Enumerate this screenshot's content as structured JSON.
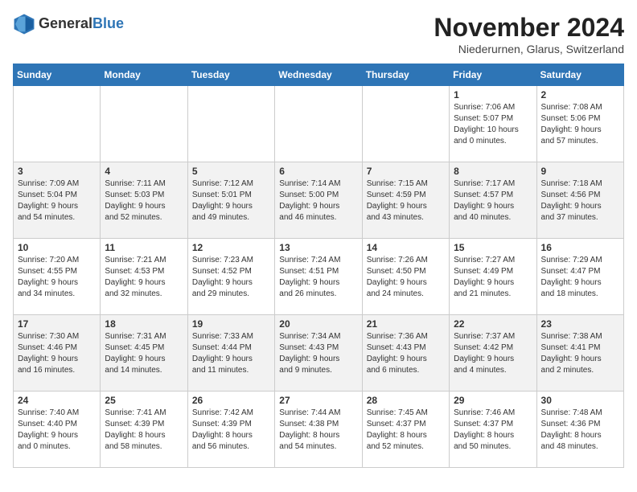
{
  "logo": {
    "general": "General",
    "blue": "Blue"
  },
  "header": {
    "month_title": "November 2024",
    "subtitle": "Niederurnen, Glarus, Switzerland"
  },
  "weekdays": [
    "Sunday",
    "Monday",
    "Tuesday",
    "Wednesday",
    "Thursday",
    "Friday",
    "Saturday"
  ],
  "weeks": [
    [
      {
        "day": "",
        "info": ""
      },
      {
        "day": "",
        "info": ""
      },
      {
        "day": "",
        "info": ""
      },
      {
        "day": "",
        "info": ""
      },
      {
        "day": "",
        "info": ""
      },
      {
        "day": "1",
        "info": "Sunrise: 7:06 AM\nSunset: 5:07 PM\nDaylight: 10 hours\nand 0 minutes."
      },
      {
        "day": "2",
        "info": "Sunrise: 7:08 AM\nSunset: 5:06 PM\nDaylight: 9 hours\nand 57 minutes."
      }
    ],
    [
      {
        "day": "3",
        "info": "Sunrise: 7:09 AM\nSunset: 5:04 PM\nDaylight: 9 hours\nand 54 minutes."
      },
      {
        "day": "4",
        "info": "Sunrise: 7:11 AM\nSunset: 5:03 PM\nDaylight: 9 hours\nand 52 minutes."
      },
      {
        "day": "5",
        "info": "Sunrise: 7:12 AM\nSunset: 5:01 PM\nDaylight: 9 hours\nand 49 minutes."
      },
      {
        "day": "6",
        "info": "Sunrise: 7:14 AM\nSunset: 5:00 PM\nDaylight: 9 hours\nand 46 minutes."
      },
      {
        "day": "7",
        "info": "Sunrise: 7:15 AM\nSunset: 4:59 PM\nDaylight: 9 hours\nand 43 minutes."
      },
      {
        "day": "8",
        "info": "Sunrise: 7:17 AM\nSunset: 4:57 PM\nDaylight: 9 hours\nand 40 minutes."
      },
      {
        "day": "9",
        "info": "Sunrise: 7:18 AM\nSunset: 4:56 PM\nDaylight: 9 hours\nand 37 minutes."
      }
    ],
    [
      {
        "day": "10",
        "info": "Sunrise: 7:20 AM\nSunset: 4:55 PM\nDaylight: 9 hours\nand 34 minutes."
      },
      {
        "day": "11",
        "info": "Sunrise: 7:21 AM\nSunset: 4:53 PM\nDaylight: 9 hours\nand 32 minutes."
      },
      {
        "day": "12",
        "info": "Sunrise: 7:23 AM\nSunset: 4:52 PM\nDaylight: 9 hours\nand 29 minutes."
      },
      {
        "day": "13",
        "info": "Sunrise: 7:24 AM\nSunset: 4:51 PM\nDaylight: 9 hours\nand 26 minutes."
      },
      {
        "day": "14",
        "info": "Sunrise: 7:26 AM\nSunset: 4:50 PM\nDaylight: 9 hours\nand 24 minutes."
      },
      {
        "day": "15",
        "info": "Sunrise: 7:27 AM\nSunset: 4:49 PM\nDaylight: 9 hours\nand 21 minutes."
      },
      {
        "day": "16",
        "info": "Sunrise: 7:29 AM\nSunset: 4:47 PM\nDaylight: 9 hours\nand 18 minutes."
      }
    ],
    [
      {
        "day": "17",
        "info": "Sunrise: 7:30 AM\nSunset: 4:46 PM\nDaylight: 9 hours\nand 16 minutes."
      },
      {
        "day": "18",
        "info": "Sunrise: 7:31 AM\nSunset: 4:45 PM\nDaylight: 9 hours\nand 14 minutes."
      },
      {
        "day": "19",
        "info": "Sunrise: 7:33 AM\nSunset: 4:44 PM\nDaylight: 9 hours\nand 11 minutes."
      },
      {
        "day": "20",
        "info": "Sunrise: 7:34 AM\nSunset: 4:43 PM\nDaylight: 9 hours\nand 9 minutes."
      },
      {
        "day": "21",
        "info": "Sunrise: 7:36 AM\nSunset: 4:43 PM\nDaylight: 9 hours\nand 6 minutes."
      },
      {
        "day": "22",
        "info": "Sunrise: 7:37 AM\nSunset: 4:42 PM\nDaylight: 9 hours\nand 4 minutes."
      },
      {
        "day": "23",
        "info": "Sunrise: 7:38 AM\nSunset: 4:41 PM\nDaylight: 9 hours\nand 2 minutes."
      }
    ],
    [
      {
        "day": "24",
        "info": "Sunrise: 7:40 AM\nSunset: 4:40 PM\nDaylight: 9 hours\nand 0 minutes."
      },
      {
        "day": "25",
        "info": "Sunrise: 7:41 AM\nSunset: 4:39 PM\nDaylight: 8 hours\nand 58 minutes."
      },
      {
        "day": "26",
        "info": "Sunrise: 7:42 AM\nSunset: 4:39 PM\nDaylight: 8 hours\nand 56 minutes."
      },
      {
        "day": "27",
        "info": "Sunrise: 7:44 AM\nSunset: 4:38 PM\nDaylight: 8 hours\nand 54 minutes."
      },
      {
        "day": "28",
        "info": "Sunrise: 7:45 AM\nSunset: 4:37 PM\nDaylight: 8 hours\nand 52 minutes."
      },
      {
        "day": "29",
        "info": "Sunrise: 7:46 AM\nSunset: 4:37 PM\nDaylight: 8 hours\nand 50 minutes."
      },
      {
        "day": "30",
        "info": "Sunrise: 7:48 AM\nSunset: 4:36 PM\nDaylight: 8 hours\nand 48 minutes."
      }
    ]
  ]
}
